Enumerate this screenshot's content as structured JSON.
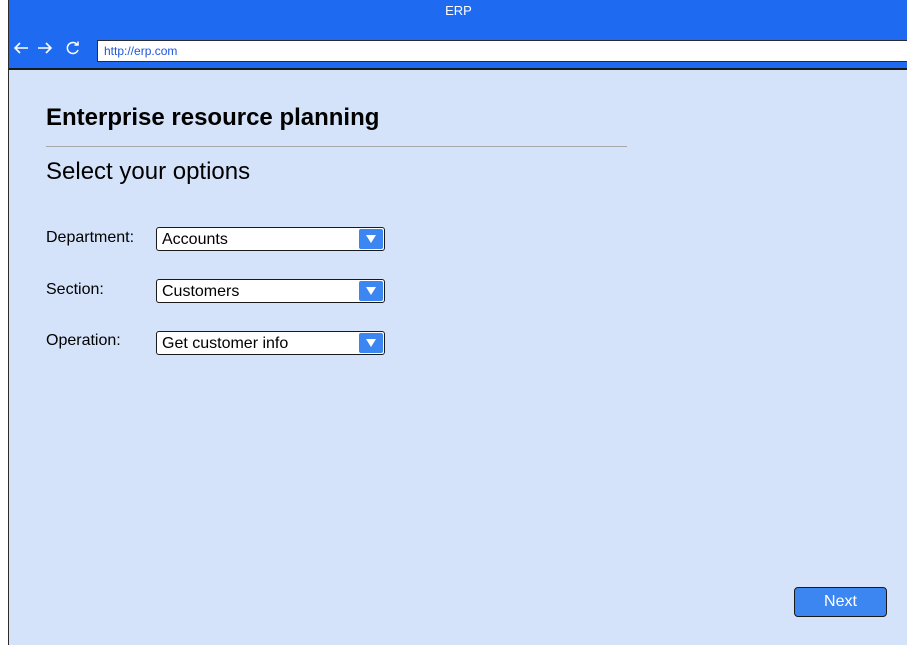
{
  "window": {
    "title": "ERP",
    "url": "http://erp.com"
  },
  "nav": {
    "back_icon": "back-arrow-icon",
    "forward_icon": "forward-arrow-icon",
    "reload_icon": "reload-icon"
  },
  "page": {
    "title": "Enterprise resource planning",
    "subtitle": "Select your options"
  },
  "form": {
    "department": {
      "label": "Department:",
      "value": "Accounts"
    },
    "section": {
      "label": "Section:",
      "value": "Customers"
    },
    "operation": {
      "label": "Operation:",
      "value": "Get customer info"
    }
  },
  "actions": {
    "next_label": "Next"
  },
  "colors": {
    "accent": "#1e6bf2",
    "button": "#3c86f2",
    "background": "#d4e3fa",
    "url_text": "#1d56d6"
  }
}
